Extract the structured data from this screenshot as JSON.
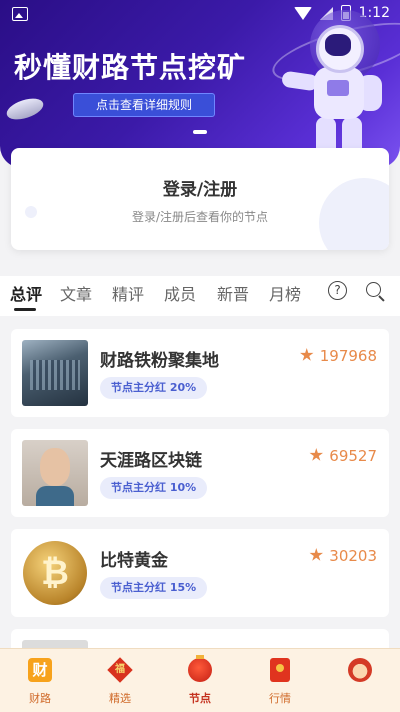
{
  "status_bar": {
    "time": "1:12"
  },
  "banner": {
    "title": "秒懂财路节点挖矿",
    "button_label": "点击查看详细规则"
  },
  "login_card": {
    "title": "登录/注册",
    "subtitle": "登录/注册后查看你的节点"
  },
  "tabs": [
    "总评",
    "文章",
    "精评",
    "成员",
    "新晋",
    "月榜"
  ],
  "help_glyph": "?",
  "nodes": [
    {
      "name": "财路铁粉聚集地",
      "tag": "节点主分红 20%",
      "score": "197968",
      "thumb": "city-icon"
    },
    {
      "name": "天涯路区块链",
      "tag": "节点主分红 10%",
      "score": "69527",
      "thumb": "avatar"
    },
    {
      "name": "比特黄金",
      "tag": "节点主分红 15%",
      "score": "30203",
      "thumb": "bitcoin-icon"
    }
  ],
  "bottom_nav": [
    {
      "label": "财路",
      "icon": "cai-icon",
      "glyph": "财"
    },
    {
      "label": "精选",
      "icon": "fu-icon",
      "glyph": "福"
    },
    {
      "label": "节点",
      "icon": "lantern-icon"
    },
    {
      "label": "行情",
      "icon": "hongbao-icon"
    },
    {
      "label": "",
      "icon": "fortune-god-icon"
    }
  ],
  "colors": {
    "accent": "#3b1aa8",
    "score": "#e88a4a",
    "tag_text": "#4a5fd0",
    "nav_bg": "#fdf2e3"
  }
}
